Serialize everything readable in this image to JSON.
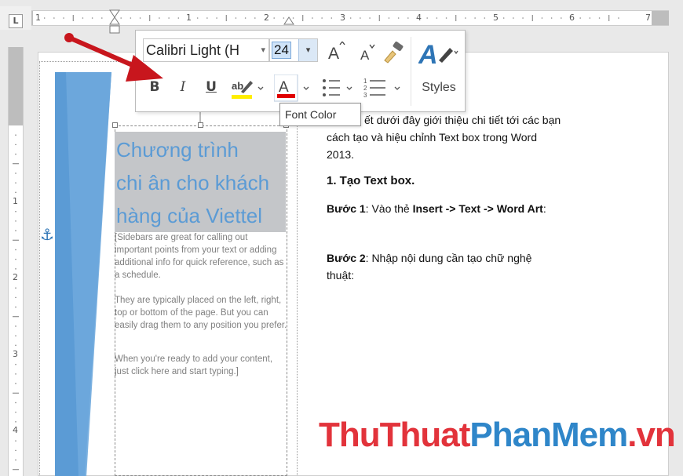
{
  "ruler": {
    "corner_glyph": "L",
    "h_numbers": [
      "1",
      "1",
      "2",
      "3",
      "4",
      "5",
      "6",
      "7"
    ],
    "v_numbers": [
      "1",
      "2",
      "3",
      "4"
    ]
  },
  "toolbar": {
    "font_name": "Calibri Light (H",
    "font_size": "24",
    "bold": "B",
    "italic": "I",
    "underline": "U",
    "styles_label": "Styles",
    "font_color_hex": "#e00000",
    "highlight_hex": "#ffee00"
  },
  "tooltip": {
    "text": "Font Color"
  },
  "sidebar": {
    "heading": [
      "Chương trình",
      "chi ân cho khách",
      "hàng của Viettel"
    ],
    "para1": "[Sidebars are great for calling out important points from your text or adding additional info for quick reference, such as a schedule.",
    "para2": "They are typically placed on the left, right, top or bottom of the page. But you can easily drag them to any position you prefer.",
    "para3": "When you're ready to add your content, just click here and start typing.]"
  },
  "document": {
    "intro_line1": "ết dưới đây giới thiệu chi tiết tới các bạn",
    "intro_line2": "cách tạo và hiệu chỉnh Text box trong Word",
    "intro_line3": "2013.",
    "heading1": "1. Tạo Text box.",
    "step1_label": "Bước 1",
    "step1_text": ": Vào thẻ ",
    "step1_bold": "Insert -> Text -> Word Art",
    "step1_end": ":",
    "step2_label": "Bước 2",
    "step2_text_line1": ": Nhập nội dung cần tạo chữ nghệ",
    "step2_text_line2": "thuật:"
  },
  "watermark": {
    "part1": "ThuThuat",
    "part2": "PhanMem",
    "part3": ".vn"
  },
  "colors": {
    "heading_blue": "#5b9bd5",
    "selection_gray": "#c4c6c9",
    "arrow_red": "#c8161d"
  }
}
